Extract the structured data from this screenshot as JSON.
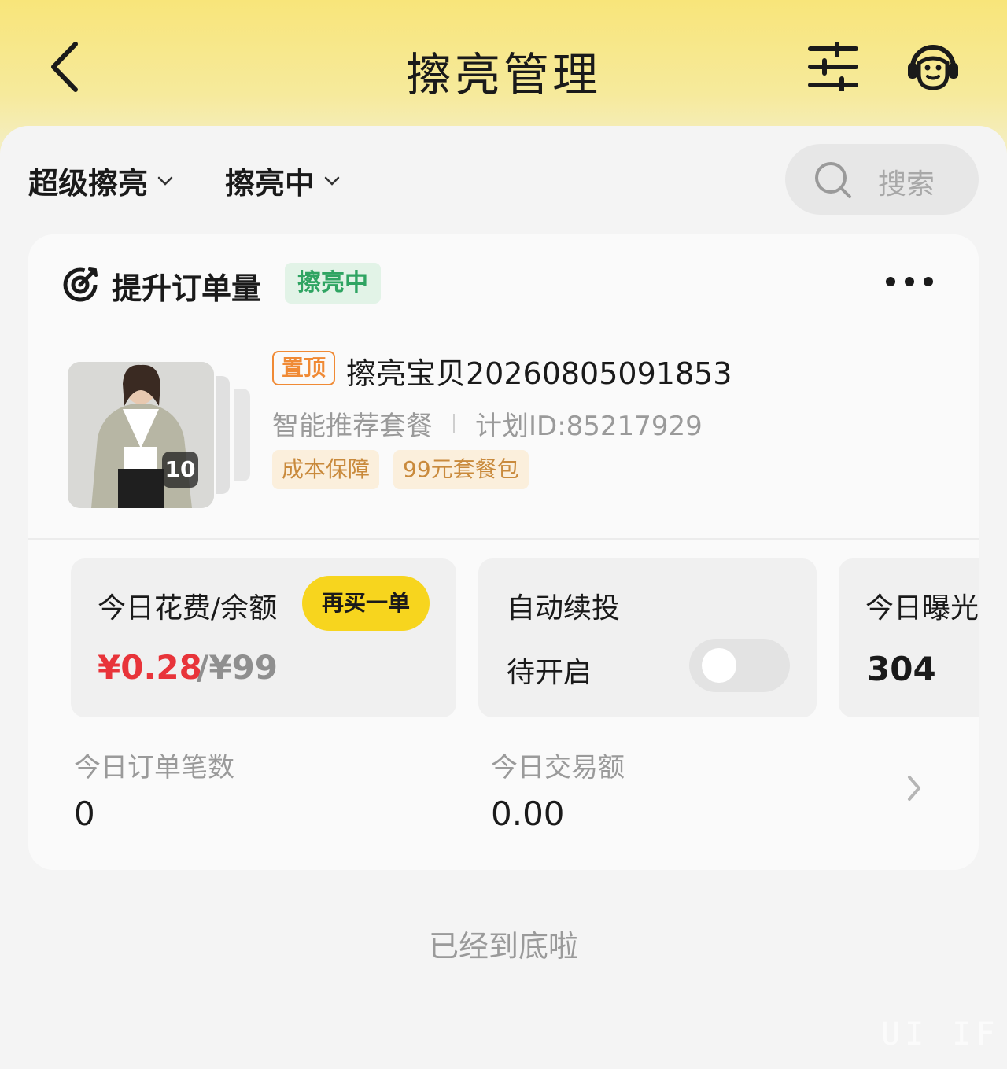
{
  "header": {
    "title": "擦亮管理",
    "back_icon": "chevron-left-icon",
    "filter_icon": "sliders-icon",
    "service_icon": "customer-service-icon"
  },
  "filters": {
    "type_label": "超级擦亮",
    "status_label": "擦亮中",
    "search_placeholder": "搜索"
  },
  "card": {
    "title": "提升订单量",
    "status": "擦亮中",
    "pin_tag": "置顶",
    "product_name": "擦亮宝贝20260805091853",
    "plan_type": "智能推荐套餐",
    "plan_id": "计划ID:85217929",
    "chips": [
      "成本保障",
      "99元套餐包"
    ],
    "image_count": "10",
    "spend_box": {
      "label": "今日花费/余额",
      "rebuy_label": "再买一单",
      "spent": "¥0.28",
      "balance": "/¥99"
    },
    "auto_box": {
      "label": "自动续投",
      "status": "待开启",
      "enabled": false
    },
    "exposure_box": {
      "label": "今日曝光",
      "value": "304"
    },
    "metrics": [
      {
        "label": "今日订单笔数",
        "value": "0"
      },
      {
        "label": "今日交易额",
        "value": "0.00"
      }
    ]
  },
  "footer": {
    "end_text": "已经到底啦",
    "watermark": "UI IF"
  },
  "colors": {
    "header_gradient_top": "#f8e57a",
    "accent_yellow": "#f7d51e",
    "status_green": "#2fa462",
    "price_red": "#e8343a",
    "pin_orange": "#f08a35",
    "chip_text": "#c98a3c"
  }
}
